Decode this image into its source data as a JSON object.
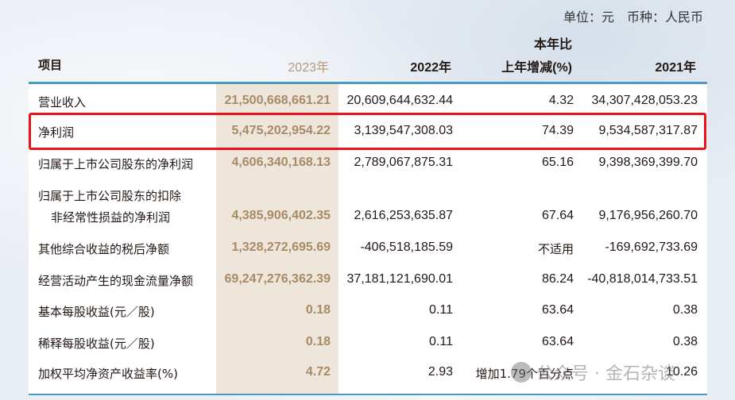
{
  "unit_note": "单位：元　币种：人民币",
  "headers": {
    "item": "项目",
    "y2023": "2023年",
    "y2022": "2022年",
    "change_line1": "本年比",
    "change_line2": "上年增减(%)",
    "y2021": "2021年"
  },
  "rows": [
    {
      "label": "营业收入",
      "y2023": "21,500,668,661.21",
      "y2022": "20,609,644,632.44",
      "change": "4.32",
      "y2021": "34,307,428,053.23"
    },
    {
      "label": "净利润",
      "y2023": "5,475,202,954.22",
      "y2022": "3,139,547,308.03",
      "change": "74.39",
      "y2021": "9,534,587,317.87",
      "highlighted": true
    },
    {
      "label": "归属于上市公司股东的净利润",
      "y2023": "4,606,340,168.13",
      "y2022": "2,789,067,875.31",
      "change": "65.16",
      "y2021": "9,398,369,399.70"
    },
    {
      "label": "归属于上市公司股东的扣除",
      "label2": "非经常性损益的净利润",
      "y2023": "4,385,906,402.35",
      "y2022": "2,616,253,635.87",
      "change": "67.64",
      "y2021": "9,176,956,260.70"
    },
    {
      "label": "其他综合收益的税后净额",
      "y2023": "1,328,272,695.69",
      "y2022": "-406,518,185.59",
      "change": "不适用",
      "y2021": "-169,692,733.69"
    },
    {
      "label": "经营活动产生的现金流量净额",
      "y2023": "69,247,276,362.39",
      "y2022": "37,181,121,690.01",
      "change": "86.24",
      "y2021": "-40,818,014,733.51"
    },
    {
      "label": "基本每股收益(元／股)",
      "y2023": "0.18",
      "y2022": "0.11",
      "change": "63.64",
      "y2021": "0.38"
    },
    {
      "label": "稀释每股收益(元／股)",
      "y2023": "0.18",
      "y2022": "0.11",
      "change": "63.64",
      "y2021": "0.38"
    },
    {
      "label": "加权平均净资产收益率(%)",
      "y2023": "4.72",
      "y2022": "2.93",
      "change": "增加1.79个百分点",
      "y2021": "10.26"
    }
  ],
  "watermark": "公众号 · 金石杂谈",
  "colors": {
    "highlight_col": "#eee6da",
    "header_2023": "#a88a66",
    "rule": "#4a9ac4",
    "red_box": "#e8141a"
  }
}
